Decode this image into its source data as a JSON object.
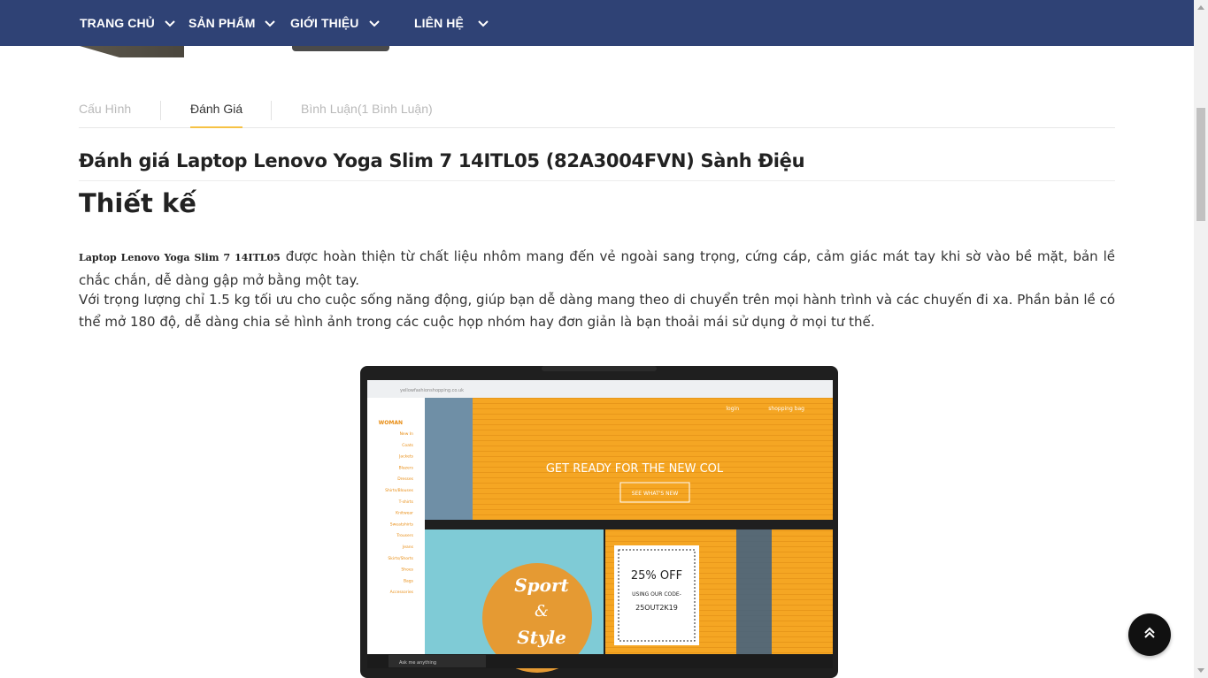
{
  "nav": {
    "items": [
      {
        "label": "TRANG CHỦ"
      },
      {
        "label": "SẢN PHẨM"
      },
      {
        "label": "GIỚI THIỆU"
      },
      {
        "label": "LIÊN HỆ"
      }
    ]
  },
  "tabs": [
    {
      "label": "Cấu Hình",
      "active": false
    },
    {
      "label": "Đánh Giá",
      "active": true
    },
    {
      "label": "Bình Luận(1 Bình Luận)",
      "active": false
    }
  ],
  "article": {
    "title": "Đánh giá Laptop Lenovo Yoga Slim 7 14ITL05 (82A3004FVN) Sành Điệu",
    "section_heading": "Thiết kế",
    "para1_product": "Laptop Lenovo Yoga Slim 7 14ITL05",
    "para1_text": "  được hoàn thiện từ chất liệu nhôm mang đến vẻ ngoài sang trọng, cứng cáp, cảm giác mát tay khi sờ vào bề mặt, bản lề chắc chắn, dễ dàng gập mở bằng một tay.",
    "para2_text": "Với trọng lượng chỉ 1.5 kg tối ưu cho cuộc sống năng động, giúp bạn dễ dàng mang theo di chuyển trên mọi hành trình và các chuyến đi xa. Phần bản lề có thể mở 180 độ, dễ dàng chia sẻ hình ảnh trong các cuộc họp nhóm hay đơn giản là bạn thoải mái sử dụng ở mọi tư thế."
  },
  "laptop_screen": {
    "url": "yellowfashionshopping.co.uk",
    "menu_heading": "WOMAN",
    "menu_items": [
      "New In",
      "Coats",
      "Jackets",
      "Blazers",
      "Dresses",
      "Shirts/Blouses",
      "T-shirts",
      "Knitwear",
      "Sweatshirts",
      "Trousers",
      "Jeans",
      "Skirts/Shorts",
      "Shoes",
      "Bags",
      "Accessories"
    ],
    "header_links": [
      "login",
      "shopping bag"
    ],
    "hero_text": "GET READY FOR THE NEW COL",
    "hero_button": "SEE WHAT'S NEW",
    "promo_left_1": "Sport",
    "promo_left_2": "&",
    "promo_left_3": "Style",
    "promo_right_1": "25% OFF",
    "promo_right_2": "USING OUR CODE-",
    "promo_right_3": "25OUT2K19",
    "taskbar_search": "Ask me anything"
  },
  "colors": {
    "nav_bg": "#2f4275",
    "tab_active_underline": "#f6c244",
    "promo_orange": "#f5a623"
  },
  "icons": {
    "nav_chevron": "chevron-down-icon",
    "back_to_top": "double-chevron-up-icon"
  }
}
